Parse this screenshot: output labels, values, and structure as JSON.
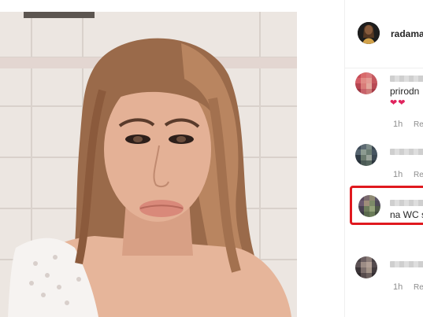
{
  "post": {
    "username": "radama",
    "image_alt": "selfie photo"
  },
  "comments": [
    {
      "text": "prirodn",
      "hearts": "❤❤",
      "time": "1h",
      "reply_label": "Re"
    },
    {
      "text": "",
      "time": "1h",
      "reply_label": "Re"
    },
    {
      "text": "na WC s",
      "time": "",
      "reply_label": "",
      "highlighted": true
    },
    {
      "text": "",
      "time": "1h",
      "reply_label": "Re"
    }
  ],
  "colors": {
    "highlight_border": "#e0191f",
    "heart": "#e0245e",
    "meta_gray": "#8e8e8e"
  }
}
